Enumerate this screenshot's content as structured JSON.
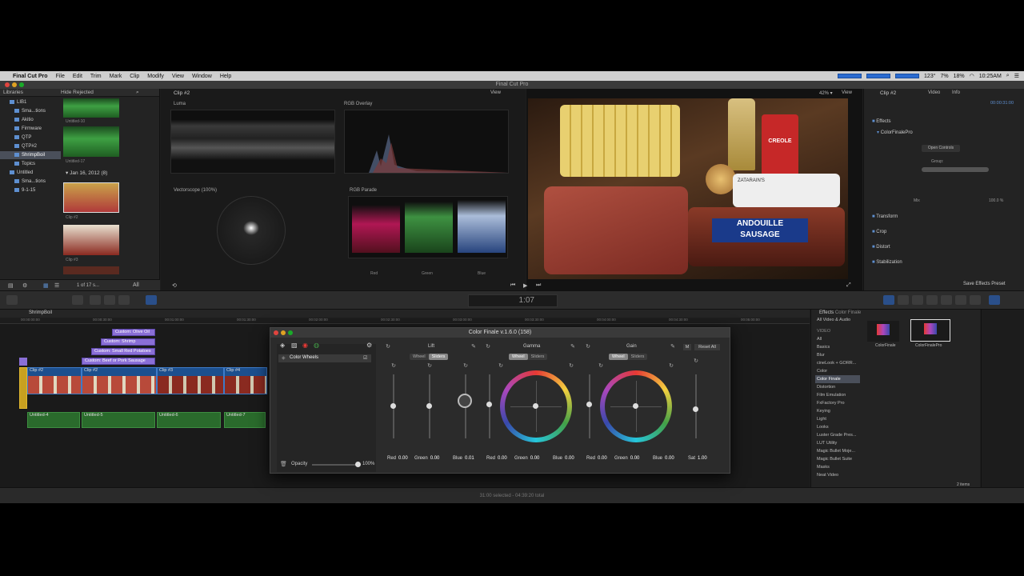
{
  "menubar": {
    "app": "Final Cut Pro",
    "items": [
      "File",
      "Edit",
      "Trim",
      "Mark",
      "Clip",
      "Modify",
      "View",
      "Window",
      "Help"
    ],
    "temp": "123°",
    "battery": "7%",
    "cpu": "18%",
    "clock": "10:25AM"
  },
  "window": {
    "title": "Final Cut Pro"
  },
  "libraries": {
    "header": "Libraries",
    "filter": "Hide Rejected",
    "items": [
      "LIB1",
      "Sma...tions",
      "Akitio",
      "Firmware",
      "QTP",
      "QTP#2",
      "ShrimpBoil",
      "Topics",
      "Untitled",
      "Sma...tions",
      "9-1-15"
    ],
    "selected_index": 6,
    "date_group": "Jan 16, 2012",
    "date_count": "(8)",
    "thumb_labels": [
      "Untitled-10",
      "Untitled-17",
      "Clip #2",
      "Clip #3"
    ],
    "count": "1 of 17 s..."
  },
  "scopes": {
    "clip": "Clip #2",
    "view": "View",
    "luma": "Luma",
    "rgb_overlay": "RGB Overlay",
    "vectorscope": "Vectorscope (100%)",
    "rgb_parade": "RGB Parade",
    "parade_labels": [
      "Red",
      "Green",
      "Blue"
    ]
  },
  "viewer": {
    "zoom": "42%",
    "view": "View",
    "timecode": "1:07",
    "label_left": "ANDOUILLE",
    "label_right": "SAUSAGE",
    "bag": "ZATARAIN'S",
    "jar": "CREOLE"
  },
  "inspector": {
    "clip": "Clip #2",
    "tabs": [
      "Video",
      "Info"
    ],
    "duration": "00:00:31:00",
    "sections": [
      "Effects",
      "ColorFinalePro",
      "Transform",
      "Crop",
      "Distort",
      "Stabilization"
    ],
    "open_controls": "Open Controls",
    "group": "Group:",
    "mix": "Mix",
    "mix_value": "100.0 %",
    "save_preset": "Save Effects Preset"
  },
  "timeline": {
    "project": "ShrimpBoil",
    "titles": [
      "Custom: Olive Oil",
      "Custom: Shrimp",
      "Custom: Small Red Potatoes",
      "Custom: Beef or Pork Sausage"
    ],
    "clips": [
      "Clip #2",
      "Clip #2",
      "Clip #3",
      "Clip #4"
    ],
    "audio": [
      "Untitled-4",
      "Untitled-5",
      "Untitled-6",
      "Untitled-7"
    ],
    "ruler": [
      "00:00:00:00",
      "00:00:30:00",
      "00:01:00:00",
      "00:01:30:00",
      "00:02:00:00",
      "00:02:30:00",
      "00:03:00:00",
      "00:03:30:00",
      "00:04:00:00",
      "00:04:30:00",
      "00:05:00:00"
    ]
  },
  "effects": {
    "title": "Effects",
    "subtitle": "Color Finale",
    "group": "All Video & Audio",
    "section": "VIDEO",
    "categories": [
      "All",
      "Basics",
      "Blur",
      "cineLook + GORR...",
      "Color",
      "Color Finale",
      "Distortion",
      "Film Emulation",
      "FxFactory Pro",
      "Keying",
      "Light",
      "Looks",
      "Luster Grade Pres...",
      "LUT Utility",
      "Magic Bullet Moje...",
      "Magic Bullet Suite",
      "Masks",
      "Neat Video"
    ],
    "selected_index": 5,
    "items": [
      "ColorFinale",
      "ColorFinalePro"
    ],
    "count": "2 items"
  },
  "status": {
    "text": "31:00 selected - 04:39:20 total"
  },
  "colorfinale": {
    "title": "Color Finale v.1.6.0 (158)",
    "layer": "Color Wheels",
    "opacity_label": "Opacity",
    "opacity_value": "100%",
    "opacity_level": 1.0,
    "sections": [
      {
        "name": "Lift",
        "mode_a": "Wheel",
        "mode_b": "Sliders",
        "values": [
          [
            "Red",
            "0.00"
          ],
          [
            "Green",
            "0.00"
          ],
          [
            "Blue",
            "0.01"
          ]
        ]
      },
      {
        "name": "Gamma",
        "mode_a": "Wheel",
        "mode_b": "Sliders",
        "values": [
          [
            "Red",
            "0.00"
          ],
          [
            "Green",
            "0.00"
          ],
          [
            "Blue",
            "0.00"
          ]
        ]
      },
      {
        "name": "Gain",
        "mode_a": "Wheel",
        "mode_b": "Sliders",
        "values": [
          [
            "Red",
            "0.00"
          ],
          [
            "Green",
            "0.00"
          ],
          [
            "Blue",
            "0.00"
          ]
        ]
      }
    ],
    "sat_label": "Sat",
    "sat_value": "1.00",
    "m_btn": "M",
    "reset_all": "Reset All"
  }
}
